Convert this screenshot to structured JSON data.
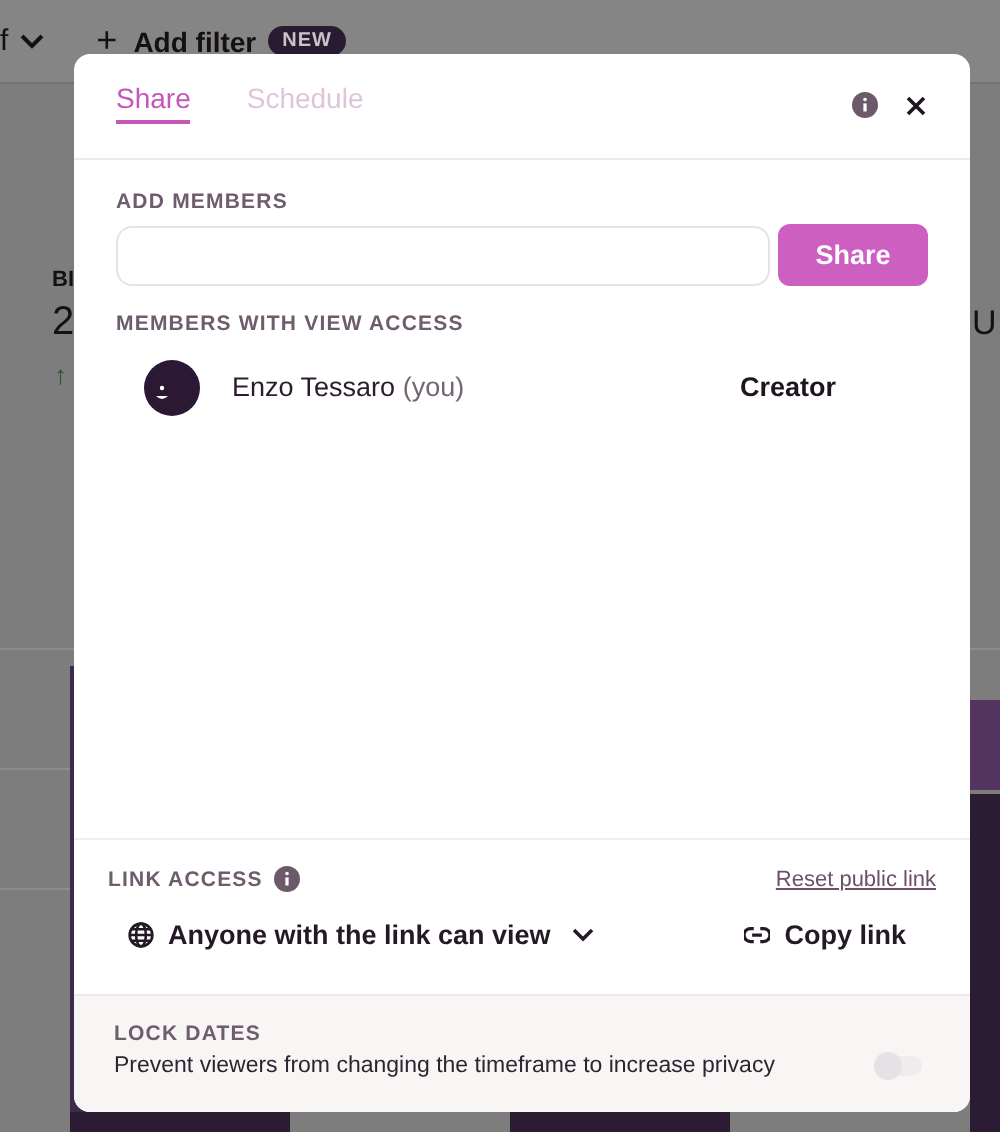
{
  "background": {
    "filter_menu": "f",
    "add_filter": {
      "icon": "+",
      "label": "Add filter",
      "badge": "NEW"
    },
    "metric_label": "BI",
    "metric_value": "2",
    "metric_trend": "↑",
    "metric_value_right": "U"
  },
  "dialog": {
    "tabs": [
      {
        "label": "Share",
        "selected": true
      },
      {
        "label": "Schedule",
        "selected": false
      }
    ],
    "add_members": {
      "label": "ADD MEMBERS",
      "button": "Share"
    },
    "members_label": "MEMBERS WITH VIEW ACCESS",
    "members": [
      {
        "name": "Enzo Tessaro",
        "suffix": "(you)",
        "role": "Creator"
      }
    ],
    "link_access": {
      "label": "LINK ACCESS",
      "reset": "Reset public link",
      "access": "Anyone with the link can view",
      "copy": "Copy link"
    },
    "lock_dates": {
      "label": "LOCK DATES",
      "description": "Prevent viewers from changing the timeframe to increase privacy",
      "on": false
    }
  }
}
